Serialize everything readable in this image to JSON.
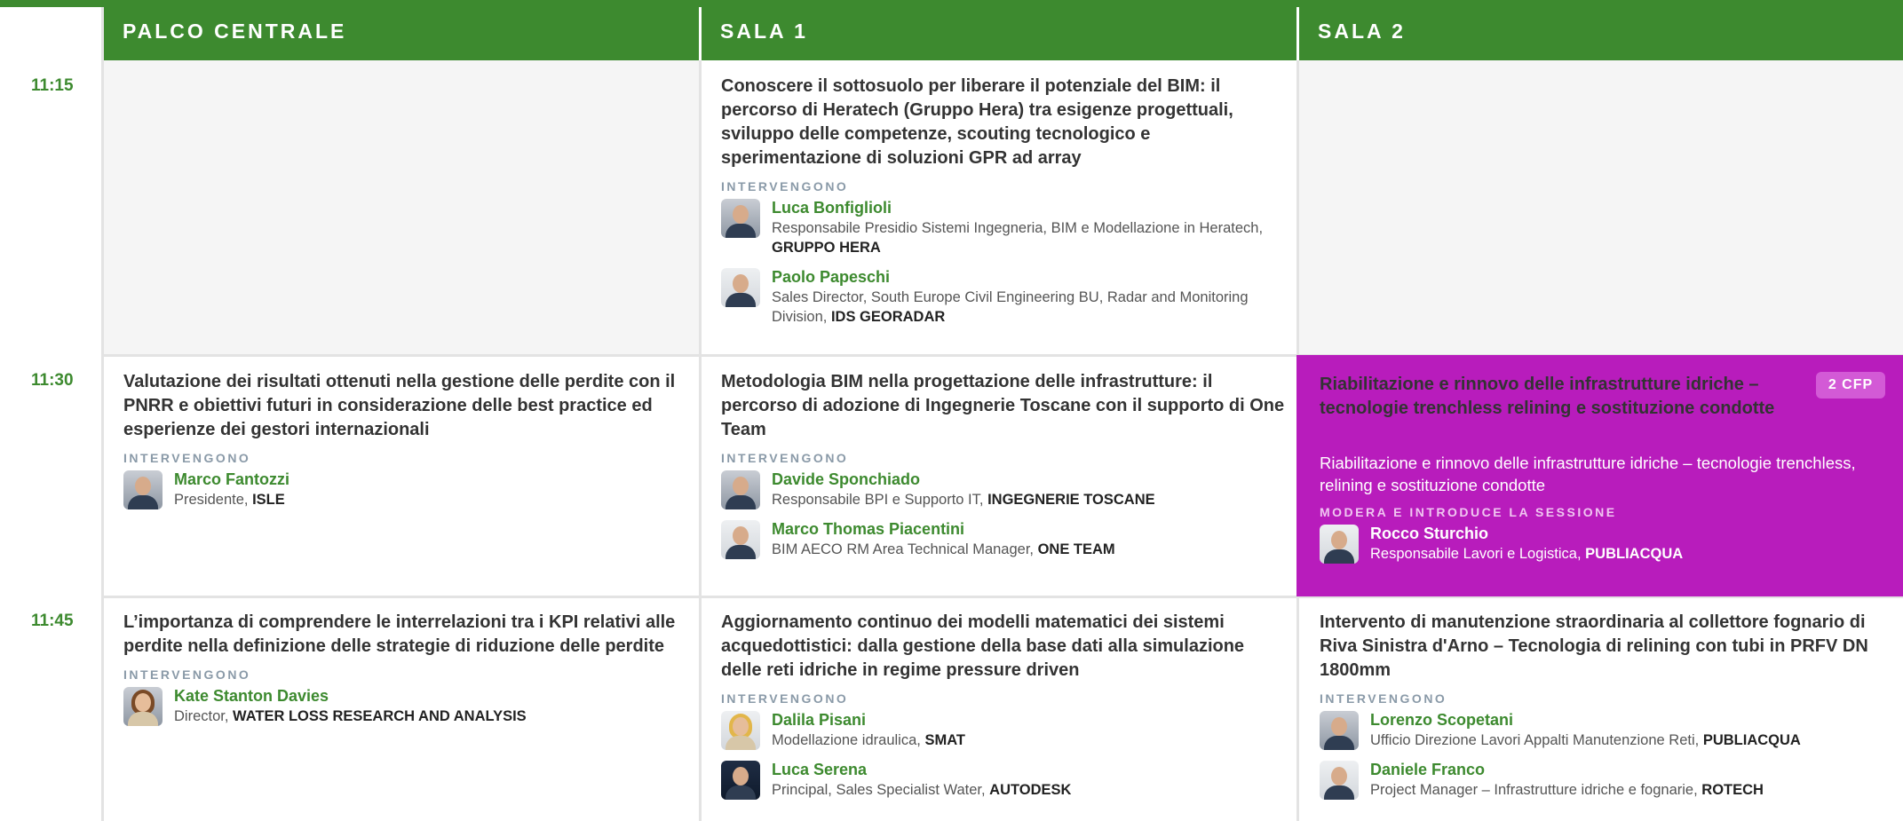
{
  "colors": {
    "header_green": "#3d8a2f",
    "highlight_magenta": "#b81cbc",
    "label_gray": "#8a9aa8"
  },
  "columns": [
    "PALCO CENTRALE",
    "SALA 1",
    "SALA 2"
  ],
  "times": [
    "11:15",
    "11:30",
    "11:45"
  ],
  "sessions": {
    "s1115_sala1": {
      "title": "Conoscere il sottosuolo per liberare il potenziale del BIM: il percorso di Heratech (Gruppo Hera) tra esigenze progettuali, sviluppo delle competenze, scouting tecnologico e sperimentazione di soluzioni GPR ad array",
      "label": "INTERVENGONO",
      "speakers": [
        {
          "name": "Luca Bonfiglioli",
          "role": "Responsabile Presidio Sistemi Ingegneria, BIM e Modellazione in Heratech, ",
          "org": "GRUPPO HERA",
          "avatar": "male-portrait-icon"
        },
        {
          "name": "Paolo Papeschi",
          "role": "Sales Director, South Europe Civil Engineering BU, Radar and Monitoring Division, ",
          "org": "IDS GEORADAR",
          "avatar": "male-portrait-icon"
        }
      ]
    },
    "s1130_palco": {
      "title": "Valutazione dei risultati ottenuti nella gestione delle perdite con il PNRR e obiettivi futuri in considerazione delle best practice ed esperienze dei gestori internazionali",
      "label": "INTERVENGONO",
      "speakers": [
        {
          "name": "Marco Fantozzi",
          "role": "Presidente, ",
          "org": "ISLE",
          "avatar": "male-portrait-icon"
        }
      ]
    },
    "s1130_sala1": {
      "title": "Metodologia BIM nella progettazione delle infrastrutture: il percorso di adozione di Ingegnerie Toscane con il supporto di One Team",
      "label": "INTERVENGONO",
      "speakers": [
        {
          "name": "Davide Sponchiado",
          "role": "Responsabile BPI e Supporto IT, ",
          "org": "INGEGNERIE TOSCANE",
          "avatar": "male-portrait-icon"
        },
        {
          "name": "Marco Thomas Piacentini",
          "role": "BIM AECO RM Area Technical Manager, ",
          "org": "ONE TEAM",
          "avatar": "male-portrait-icon"
        }
      ]
    },
    "s1130_sala2": {
      "title": "Riabilitazione e rinnovo delle infrastrutture idriche – tecnologie trenchless relining e sostituzione condotte",
      "subtitle": "Riabilitazione e rinnovo delle infrastrutture idriche – tecnologie trenchless, relining e sostituzione condotte",
      "badge": "2 CFP",
      "label": "MODERA E INTRODUCE LA SESSIONE",
      "speakers": [
        {
          "name": "Rocco Sturchio",
          "role": "Responsabile Lavori e Logistica, ",
          "org": "PUBLIACQUA",
          "avatar": "male-portrait-icon"
        }
      ]
    },
    "s1145_palco": {
      "title": "L’importanza di comprendere le interrelazioni tra i KPI relativi alle perdite nella definizione delle strategie di riduzione delle perdite",
      "label": "INTERVENGONO",
      "speakers": [
        {
          "name": "Kate Stanton Davies",
          "role": "Director, ",
          "org": "WATER LOSS RESEARCH AND ANALYSIS",
          "avatar": "female-portrait-icon"
        }
      ]
    },
    "s1145_sala1": {
      "title": "Aggiornamento continuo dei modelli matematici dei sistemi acquedottistici: dalla gestione della base dati alla simulazione delle reti idriche in regime pressure driven",
      "label": "INTERVENGONO",
      "speakers": [
        {
          "name": "Dalila Pisani",
          "role": "Modellazione idraulica, ",
          "org": "SMAT",
          "avatar": "female-portrait-icon"
        },
        {
          "name": "Luca Serena",
          "role": "Principal, Sales Specialist Water, ",
          "org": "AUTODESK",
          "avatar": "male-portrait-icon"
        }
      ]
    },
    "s1145_sala2": {
      "title": "Intervento di manutenzione straordinaria al collettore fognario di Riva Sinistra d'Arno – Tecnologia di relining con tubi in PRFV DN 1800mm",
      "label": "INTERVENGONO",
      "speakers": [
        {
          "name": "Lorenzo Scopetani",
          "role": "Ufficio Direzione Lavori Appalti Manutenzione Reti, ",
          "org": "PUBLIACQUA",
          "avatar": "male-portrait-icon"
        },
        {
          "name": "Daniele Franco",
          "role": "Project Manager – Infrastrutture idriche e fognarie, ",
          "org": "ROTECH",
          "avatar": "male-portrait-icon"
        }
      ]
    }
  }
}
